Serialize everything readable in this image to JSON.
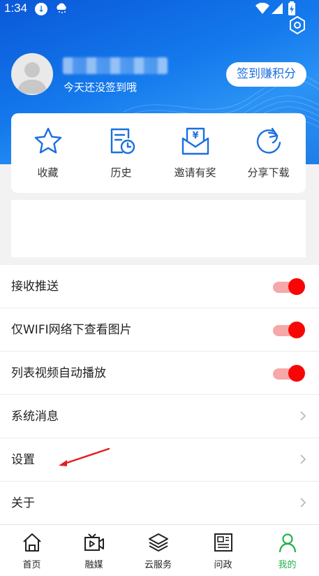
{
  "status_bar": {
    "time": "1:34"
  },
  "profile": {
    "signin_hint": "今天还没签到哦",
    "signin_button": "签到赚积分"
  },
  "quick_actions": [
    {
      "label": "收藏",
      "icon": "star-icon"
    },
    {
      "label": "历史",
      "icon": "history-icon"
    },
    {
      "label": "邀请有奖",
      "icon": "invite-envelope-icon"
    },
    {
      "label": "分享下载",
      "icon": "share-icon"
    }
  ],
  "settings_list": [
    {
      "label": "接收推送",
      "type": "toggle",
      "on": true
    },
    {
      "label": "仅WIFI网络下查看图片",
      "type": "toggle",
      "on": true
    },
    {
      "label": "列表视频自动播放",
      "type": "toggle",
      "on": true
    },
    {
      "label": "系统消息",
      "type": "link"
    },
    {
      "label": "设置",
      "type": "link"
    },
    {
      "label": "关于",
      "type": "link"
    }
  ],
  "tabs": [
    {
      "label": "首页",
      "icon": "home-icon"
    },
    {
      "label": "融媒",
      "icon": "media-icon"
    },
    {
      "label": "云服务",
      "icon": "layers-icon"
    },
    {
      "label": "问政",
      "icon": "newspaper-icon"
    },
    {
      "label": "我的",
      "icon": "user-icon",
      "active": true
    }
  ],
  "colors": {
    "header_blue": "#1479ec",
    "accent_blue": "#1a6fe0",
    "toggle_on": "#f80606",
    "active_tab": "#22b14c",
    "annotation_arrow": "#e02020"
  }
}
